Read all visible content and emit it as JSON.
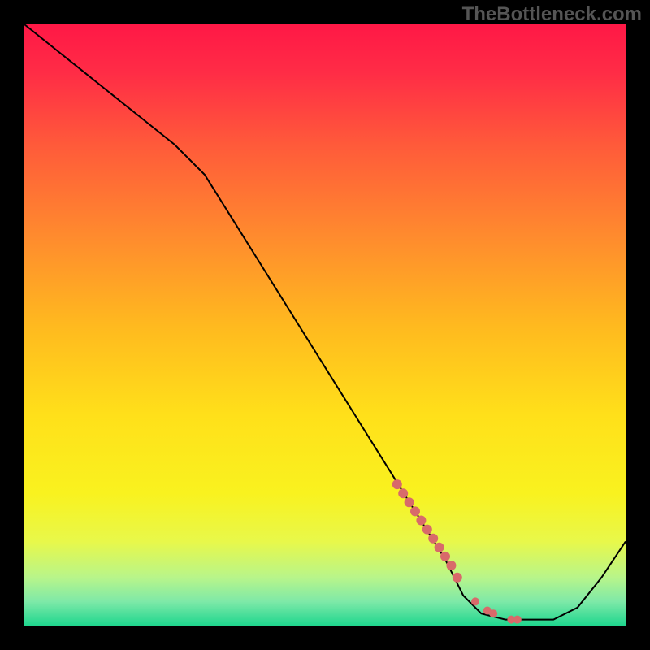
{
  "watermark": "TheBottleneck.com",
  "chart_data": {
    "type": "line",
    "title": "",
    "xlabel": "",
    "ylabel": "",
    "xlim": [
      0,
      100
    ],
    "ylim": [
      0,
      100
    ],
    "series": [
      {
        "name": "bottleneck-curve",
        "x": [
          0,
          5,
          10,
          15,
          20,
          25,
          30,
          35,
          40,
          45,
          50,
          55,
          60,
          65,
          70,
          73,
          76,
          80,
          84,
          88,
          92,
          96,
          100
        ],
        "y": [
          100,
          96,
          92,
          88,
          84,
          80,
          75,
          67,
          59,
          51,
          43,
          35,
          27,
          19,
          11,
          5,
          2,
          1,
          1,
          1,
          3,
          8,
          14
        ]
      }
    ],
    "highlight_segment": {
      "name": "highlight-dots",
      "x": [
        62,
        63,
        64,
        65,
        66,
        67,
        68,
        69,
        70,
        71,
        72,
        75,
        77,
        78,
        81,
        82
      ],
      "y": [
        23.5,
        22,
        20.5,
        19,
        17.5,
        16,
        14.5,
        13,
        11.5,
        10,
        8,
        4,
        2.5,
        2,
        1,
        1
      ]
    },
    "background_gradient": {
      "stops": [
        {
          "offset": 0.0,
          "color": "#ff1846"
        },
        {
          "offset": 0.08,
          "color": "#ff2c46"
        },
        {
          "offset": 0.2,
          "color": "#ff5a3a"
        },
        {
          "offset": 0.35,
          "color": "#ff8a2e"
        },
        {
          "offset": 0.5,
          "color": "#ffb91f"
        },
        {
          "offset": 0.65,
          "color": "#ffe01a"
        },
        {
          "offset": 0.78,
          "color": "#f9f21f"
        },
        {
          "offset": 0.86,
          "color": "#e8f84a"
        },
        {
          "offset": 0.92,
          "color": "#b8f58a"
        },
        {
          "offset": 0.96,
          "color": "#7ee9a8"
        },
        {
          "offset": 1.0,
          "color": "#1fd68e"
        }
      ]
    }
  }
}
